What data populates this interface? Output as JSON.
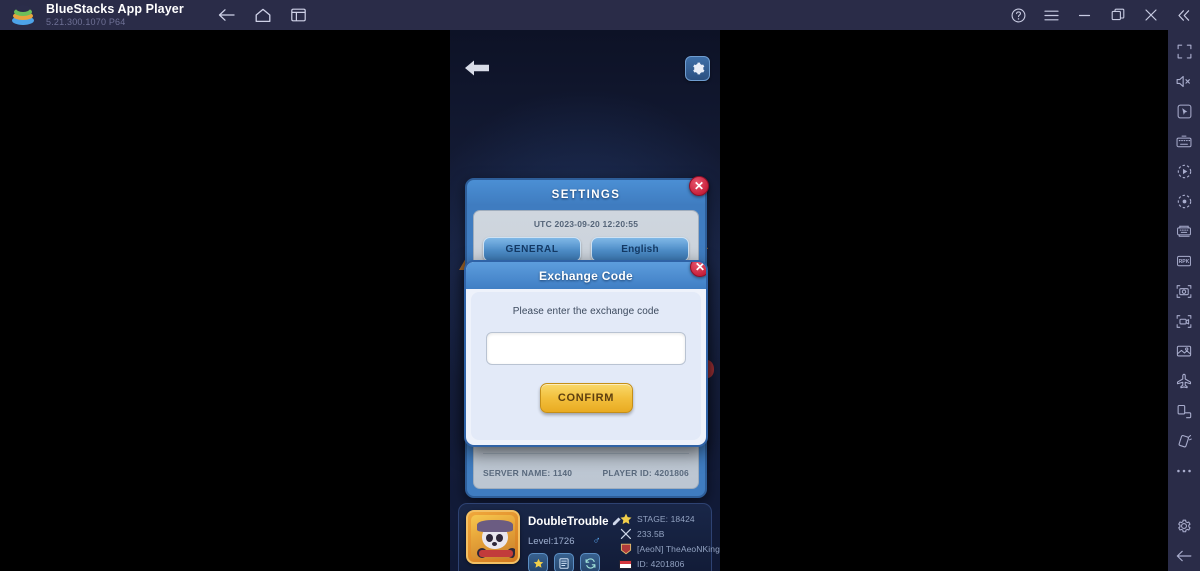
{
  "titlebar": {
    "app_name": "BlueStacks App Player",
    "version": "5.21.300.1070  P64",
    "nav": [
      {
        "name": "back-button",
        "icon": "arrow-left-icon"
      },
      {
        "name": "home-button",
        "icon": "home-icon"
      },
      {
        "name": "instances-button",
        "icon": "windows-icon"
      }
    ],
    "controls": [
      {
        "name": "help-button",
        "icon": "help-circle-icon"
      },
      {
        "name": "menu-button",
        "icon": "hamburger-icon"
      },
      {
        "name": "minimize-button",
        "icon": "minimize-icon"
      },
      {
        "name": "maximize-button",
        "icon": "maximize-icon"
      },
      {
        "name": "close-button",
        "icon": "close-icon"
      },
      {
        "name": "collapse-sidebar-button",
        "icon": "chevron-double-left-icon"
      }
    ]
  },
  "sidebar": {
    "items": [
      {
        "name": "fullscreen-icon"
      },
      {
        "name": "mute-icon"
      },
      {
        "name": "cursor-icon"
      },
      {
        "name": "keyboard-controls-icon"
      },
      {
        "name": "macro-play-icon"
      },
      {
        "name": "macro-record-icon"
      },
      {
        "name": "multi-instance-sync-icon"
      },
      {
        "name": "rpk-install-icon"
      },
      {
        "name": "screenshot-icon"
      },
      {
        "name": "video-record-icon"
      },
      {
        "name": "media-manager-icon"
      },
      {
        "name": "eco-mode-icon"
      },
      {
        "name": "rotate-icon"
      },
      {
        "name": "shake-icon"
      },
      {
        "name": "more-options-icon"
      },
      {
        "name": "settings-gear-icon"
      },
      {
        "name": "back-arrow-icon"
      }
    ]
  },
  "game": {
    "back_button": "back-arrow",
    "gear_button": "settings-gear",
    "settings_panel": {
      "title": "SETTINGS",
      "utc_time": "UTC 2023-09-20 12:20:55",
      "buttons": [
        {
          "label": "GENERAL"
        },
        {
          "label": "English"
        }
      ],
      "server_name_label": "SERVER NAME: 1140",
      "player_id_label": "PLAYER ID: 4201806",
      "close_label": "✕"
    },
    "exchange_dialog": {
      "title": "Exchange Code",
      "prompt": "Please enter the exchange code",
      "input_value": "",
      "input_placeholder": "",
      "confirm_label": "CONFIRM",
      "close_label": "✕"
    },
    "player_bar": {
      "player_name": "DoubleTrouble",
      "edit_icon": "pencil-icon",
      "level": "Level:1726",
      "gender": "♂",
      "buttons": [
        {
          "name": "badge-button",
          "icon": "star-icon"
        },
        {
          "name": "records-button",
          "icon": "list-icon"
        },
        {
          "name": "switch-account-button",
          "icon": "sync-icon"
        }
      ],
      "stats": [
        {
          "icon": "star-icon",
          "text": "STAGE: 18424"
        },
        {
          "icon": "power-icon",
          "text": "233.5B"
        },
        {
          "icon": "guild-icon",
          "text": "[AeoN] TheAeoNKings"
        },
        {
          "icon": "flag-icon",
          "text": "ID: 4201806"
        }
      ]
    }
  },
  "colors": {
    "titlebar_bg": "#2a2c48",
    "sidebar_bg": "#2a2c48",
    "dialog_header": "#3f7ec4",
    "confirm_button": "#f2bf3c",
    "close_red": "#c8213c"
  }
}
